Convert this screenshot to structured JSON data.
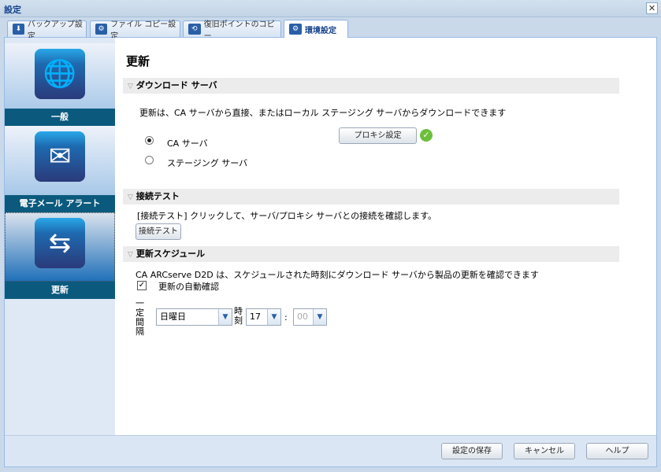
{
  "window": {
    "title": "設定",
    "close_icon": "close-icon"
  },
  "tabs": [
    {
      "label": "バックアップ設定",
      "icon": "backup-icon"
    },
    {
      "label": "ファイル コピー設定",
      "icon": "file-copy-icon"
    },
    {
      "label": "復旧ポイントのコピー",
      "icon": "recovery-copy-icon"
    },
    {
      "label": "環境設定",
      "icon": "gear-icon",
      "active": true
    }
  ],
  "sidebar": {
    "items": [
      {
        "label": "一般",
        "icon": "globe-icon"
      },
      {
        "label": "電子メール アラート",
        "icon": "email-alert-icon"
      },
      {
        "label": "更新",
        "icon": "update-arrows-icon",
        "selected": true
      }
    ]
  },
  "main": {
    "title": "更新",
    "download": {
      "header": "ダウンロード サーバ",
      "description": "更新は、CA サーバから直接、またはローカル ステージング サーバからダウンロードできます",
      "options": [
        {
          "label": "CA サーバ",
          "checked": true
        },
        {
          "label": "ステージング サーバ",
          "checked": false
        }
      ],
      "proxy_button": "プロキシ設定"
    },
    "test": {
      "header": "接続テスト",
      "description": "[接続テスト] クリックして、サーバ/プロキシ サーバとの接続を確認します。",
      "button": "接続テスト"
    },
    "schedule": {
      "header": "更新スケジュール",
      "description": "CA ARCserve D2D は、スケジュールされた時刻にダウンロード サーバから製品の更新を確認できます",
      "auto_check_label": "更新の自動確認",
      "auto_check": true,
      "interval_label": "一定間隔",
      "day": "日曜日",
      "time_label": "時刻",
      "hour": "17",
      "separator": ":",
      "minute": "00"
    }
  },
  "footer": {
    "save": "設定の保存",
    "cancel": "キャンセル",
    "help": "ヘルプ"
  }
}
